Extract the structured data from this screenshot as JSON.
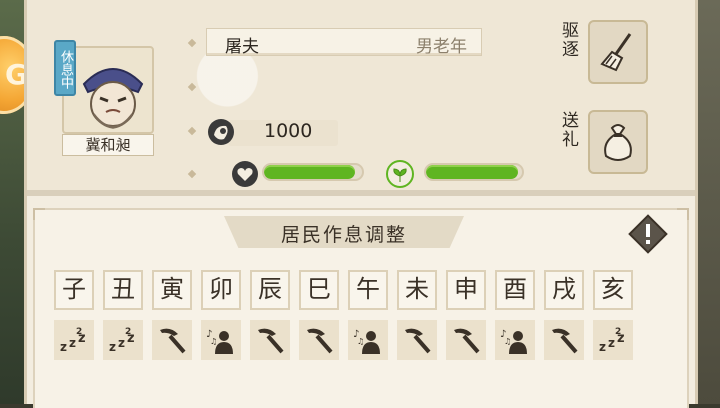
{
  "resident": {
    "status": "休息中",
    "name": "冀和昶",
    "job": "屠夫",
    "description": "男老年",
    "money": "1000",
    "health": 0.93,
    "mood": 0.96
  },
  "actions": [
    {
      "label": "驱逐",
      "icon": "broom-icon"
    },
    {
      "label": "送礼",
      "icon": "gift-bag-icon"
    }
  ],
  "schedule": {
    "title": "居民作息调整",
    "hours": [
      "子",
      "丑",
      "寅",
      "卯",
      "辰",
      "巳",
      "午",
      "未",
      "申",
      "酉",
      "戌",
      "亥"
    ],
    "activities": [
      "sleep",
      "sleep",
      "work",
      "leisure",
      "work",
      "work",
      "leisure",
      "work",
      "work",
      "leisure",
      "work",
      "sleep"
    ]
  },
  "colors": {
    "bar_green": "#5fb521",
    "status_blue": "#5aa8c7",
    "panel_bg": "#f3ede0"
  }
}
